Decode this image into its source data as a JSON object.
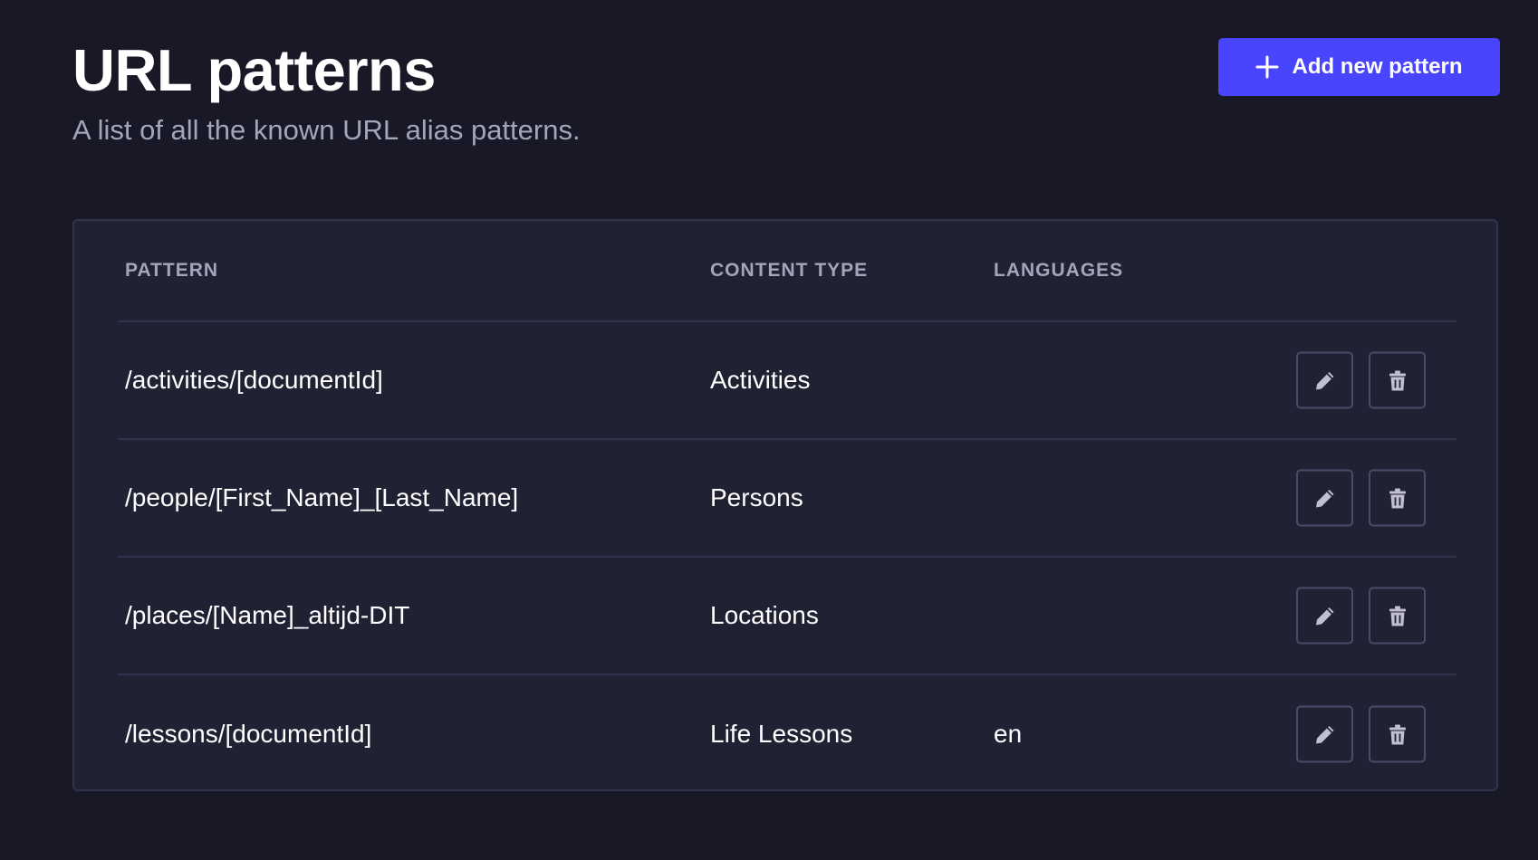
{
  "header": {
    "title": "URL patterns",
    "subtitle": "A list of all the known URL alias patterns.",
    "add_button_label": "Add new pattern",
    "add_button_icon": "plus-icon"
  },
  "table": {
    "columns": {
      "pattern": "Pattern",
      "content_type": "Content type",
      "languages": "Languages"
    },
    "rows": [
      {
        "pattern": "/activities/[documentId]",
        "content_type": "Activities",
        "languages": ""
      },
      {
        "pattern": "/people/[First_Name]_[Last_Name]",
        "content_type": "Persons",
        "languages": ""
      },
      {
        "pattern": "/places/[Name]_altijd-DIT",
        "content_type": "Locations",
        "languages": ""
      },
      {
        "pattern": "/lessons/[documentId]",
        "content_type": "Life Lessons",
        "languages": "en"
      }
    ],
    "row_actions": {
      "edit_icon": "pencil-icon",
      "delete_icon": "trash-icon"
    }
  },
  "colors": {
    "background": "#181826",
    "card": "#212134",
    "border": "#32324d",
    "accent": "#4945ff",
    "muted_text": "#a5a5ba",
    "icon": "#c0c0cf"
  }
}
